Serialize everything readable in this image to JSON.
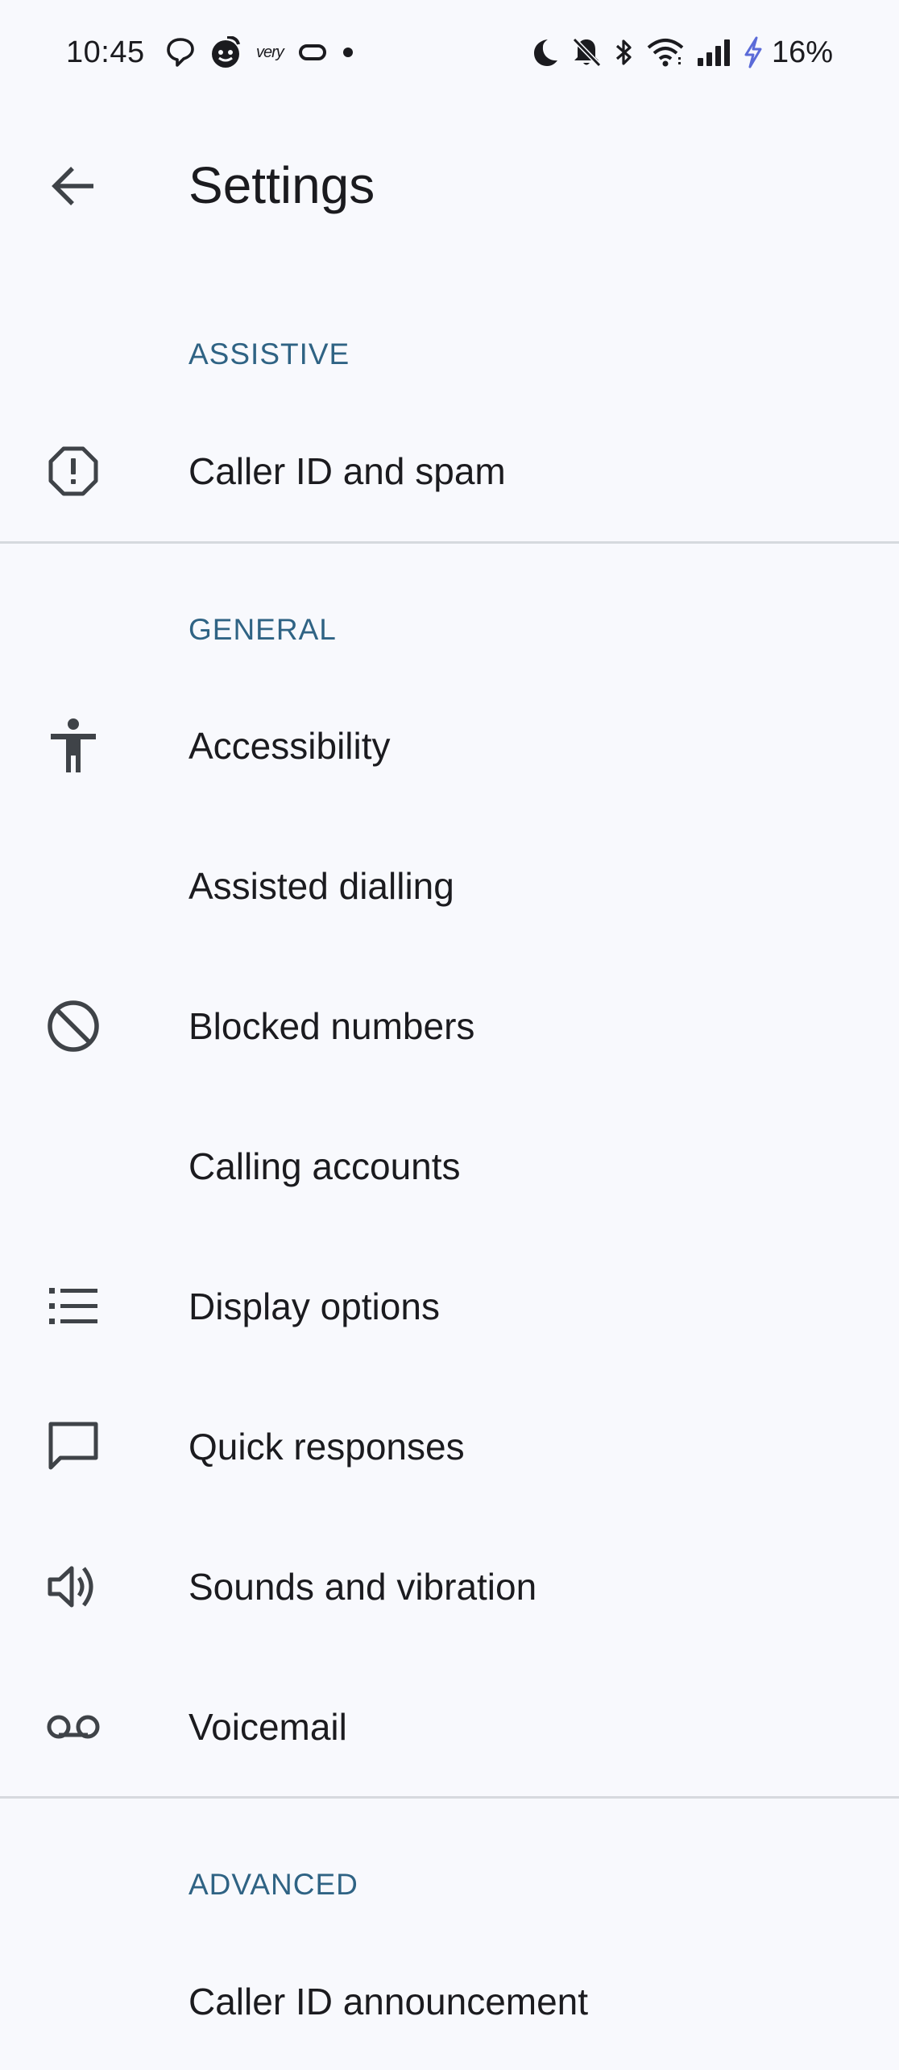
{
  "status_bar": {
    "time": "10:45",
    "notification_icons": [
      "chat-bubble-icon",
      "face-app-icon",
      "very-app-icon",
      "pill-app-icon",
      "dot-icon"
    ],
    "small_app_text": "very",
    "system_icons": [
      "do-not-disturb-moon-icon",
      "bell-off-icon",
      "bluetooth-icon",
      "wifi-icon",
      "cell-signal-icon",
      "charging-bolt-icon"
    ],
    "battery": "16%"
  },
  "header": {
    "title": "Settings",
    "back_icon": "arrow-back-icon"
  },
  "sections": [
    {
      "header": "ASSISTIVE",
      "items": [
        {
          "label": "Caller ID and spam",
          "icon": "alert-octagon-icon"
        }
      ]
    },
    {
      "header": "GENERAL",
      "items": [
        {
          "label": "Accessibility",
          "icon": "accessibility-icon"
        },
        {
          "label": "Assisted dialling",
          "icon": ""
        },
        {
          "label": "Blocked numbers",
          "icon": "block-icon"
        },
        {
          "label": "Calling accounts",
          "icon": ""
        },
        {
          "label": "Display options",
          "icon": "list-icon"
        },
        {
          "label": "Quick responses",
          "icon": "message-icon"
        },
        {
          "label": "Sounds and vibration",
          "icon": "volume-icon"
        },
        {
          "label": "Voicemail",
          "icon": "voicemail-icon"
        }
      ]
    },
    {
      "header": "ADVANCED",
      "items": [
        {
          "label": "Caller ID announcement",
          "icon": ""
        }
      ]
    }
  ],
  "colors": {
    "background": "#f8f9fd",
    "section_header": "#2f6384",
    "text": "#1b1b1f",
    "icon": "#3f4348",
    "divider": "#d6d9de",
    "charging_bolt": "#5b6bd8"
  }
}
